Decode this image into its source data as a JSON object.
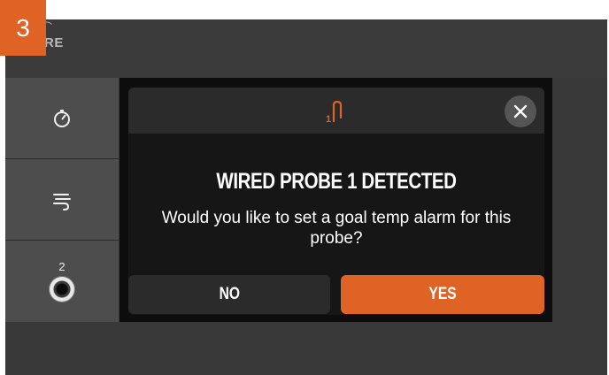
{
  "step_badge": "3",
  "brand": "RE",
  "sidebar": {
    "items": [
      {
        "icon": "timer-icon"
      },
      {
        "icon": "smoke-icon"
      },
      {
        "icon": "probe-jack-icon",
        "label": "2"
      }
    ]
  },
  "modal": {
    "header_icon": "probe-1-icon",
    "title": "WIRED PROBE 1 DETECTED",
    "body": "Would you like to set a goal temp alarm for this probe?",
    "no_label": "NO",
    "yes_label": "YES"
  },
  "colors": {
    "accent": "#e06326",
    "background": "#393939",
    "modal": "#161616"
  }
}
